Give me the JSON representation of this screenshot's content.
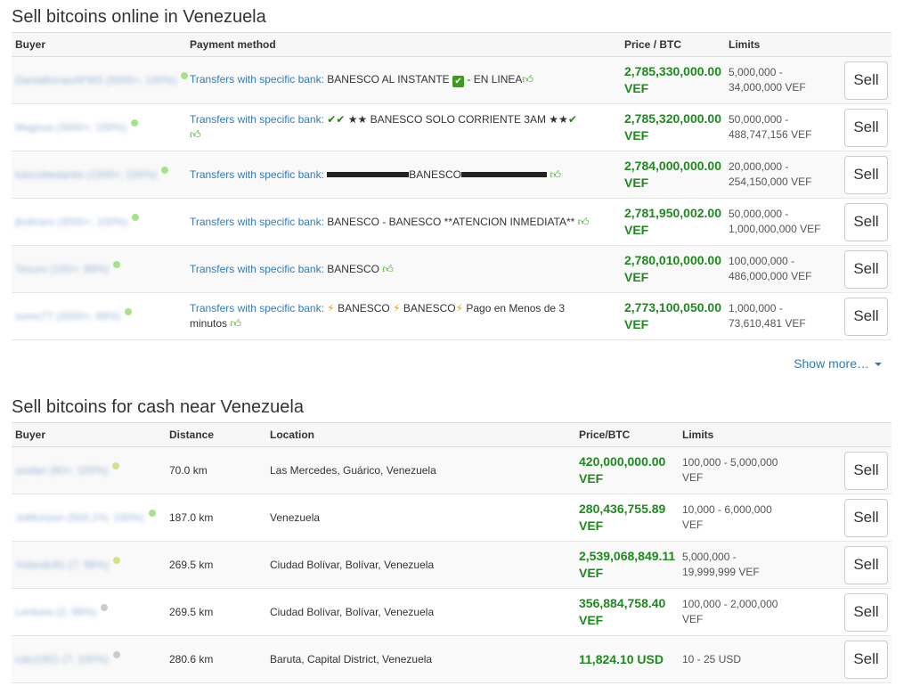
{
  "online": {
    "title": "Sell bitcoins online in Venezuela",
    "headers": {
      "buyer": "Buyer",
      "payment": "Payment method",
      "price": "Price / BTC",
      "limits": "Limits"
    },
    "rows": [
      {
        "buyer": "DaniaBonasAFMS (5000+; 100%)",
        "dot": "#a6e28a",
        "pm_link": "Transfers with specific bank:",
        "pm_text": "BANESCO AL INSTANTE",
        "pm_extra": "- EN LINEA",
        "price": "2,785,330,000.00",
        "currency": "VEF",
        "limits_1": "5,000,000 -",
        "limits_2": "34,000,000 VEF",
        "sell": "Sell"
      },
      {
        "buyer": "Magnus (3000+; 100%)",
        "dot": "#a6e28a",
        "pm_link": "Transfers with specific bank:",
        "pm_text": "★★ BANESCO SOLO CORRIENTE 3AM ★★",
        "price": "2,785,320,000.00",
        "currency": "VEF",
        "limits_1": "50,000,000 -",
        "limits_2": "488,747,156 VEF",
        "sell": "Sell"
      },
      {
        "buyer": "tuiscobedantis (1000+; 100%)",
        "dot": "#a6e28a",
        "pm_link": "Transfers with specific bank:",
        "pm_text": "BANESCO",
        "price": "2,784,000,000.00",
        "currency": "VEF",
        "limits_1": "20,000,000 -",
        "limits_2": "254,150,000 VEF",
        "sell": "Sell"
      },
      {
        "buyer": "jbolivars (3000+; 100%)",
        "dot": "#a6e28a",
        "pm_link": "Transfers with specific bank:",
        "pm_text": "BANESCO - BANESCO **ATENCION INMEDIATA**",
        "price": "2,781,950,002.00",
        "currency": "VEF",
        "limits_1": "50,000,000 -",
        "limits_2": "1,000,000,000 VEF",
        "sell": "Sell"
      },
      {
        "buyer": "Tesuro (100+; 99%)",
        "dot": "#a6e28a",
        "pm_link": "Transfers with specific bank:",
        "pm_text": "BANESCO",
        "price": "2,780,010,000.00",
        "currency": "VEF",
        "limits_1": "100,000,000 -",
        "limits_2": "486,000,000 VEF",
        "sell": "Sell"
      },
      {
        "buyer": "somo77 (3000+; 99%)",
        "dot": "#a6e28a",
        "pm_link": "Transfers with specific bank:",
        "pm_text_a": "BANESCO",
        "pm_text_b": "BANESCO",
        "pm_text_c": "Pago en Menos de 3",
        "pm_text_d": "minutos",
        "price": "2,773,100,050.00",
        "currency": "VEF",
        "limits_1": "1,000,000 -",
        "limits_2": "73,610,481 VEF",
        "sell": "Sell"
      }
    ],
    "show_more": "Show more…"
  },
  "cash": {
    "title": "Sell bitcoins for cash near Venezuela",
    "headers": {
      "buyer": "Buyer",
      "distance": "Distance",
      "location": "Location",
      "price": "Price/BTC",
      "limits": "Limits"
    },
    "rows": [
      {
        "buyer": "sealan (60+; 100%)",
        "dot": "#d4e08a",
        "distance": "70.0 km",
        "location": "Las Mercedes, Guárico, Venezuela",
        "price": "420,000,000.00",
        "currency": "VEF",
        "limits_1": "100,000 - 5,000,000",
        "limits_2": "VEF",
        "sell": "Sell"
      },
      {
        "buyer": "JoMonson (500,1%; 100%)",
        "dot": "#a6e28a",
        "distance": "187.0 km",
        "location": "Venezuela",
        "price": "280,436,755.89",
        "currency": "VEF",
        "limits_1": "10,000 - 6,000,000",
        "limits_2": "VEF",
        "sell": "Sell"
      },
      {
        "buyer": "Yolando91 (7; 99%)",
        "dot": "#d4e08a",
        "distance": "269.5 km",
        "location": "Ciudad Bolívar, Bolívar, Venezuela",
        "price": "2,539,068,849.11",
        "currency": "VEF",
        "limits_1": "5,000,000 -",
        "limits_2": "19,999,999 VEF",
        "sell": "Sell"
      },
      {
        "buyer": "Lentons (2; 99%)",
        "dot": "#cccccc",
        "distance": "269.5 km",
        "location": "Ciudad Bolívar, Bolívar, Venezuela",
        "price": "356,884,758.40",
        "currency": "VEF",
        "limits_1": "100,000 - 2,000,000",
        "limits_2": "VEF",
        "sell": "Sell"
      },
      {
        "buyer": "catu1901 (7; 100%)",
        "dot": "#cccccc",
        "distance": "280.6 km",
        "location": "Baruta, Capital District, Venezuela",
        "price": "11,824.10 USD",
        "currency": "",
        "limits_1": "10 - 25 USD",
        "limits_2": "",
        "sell": "Sell"
      }
    ]
  }
}
